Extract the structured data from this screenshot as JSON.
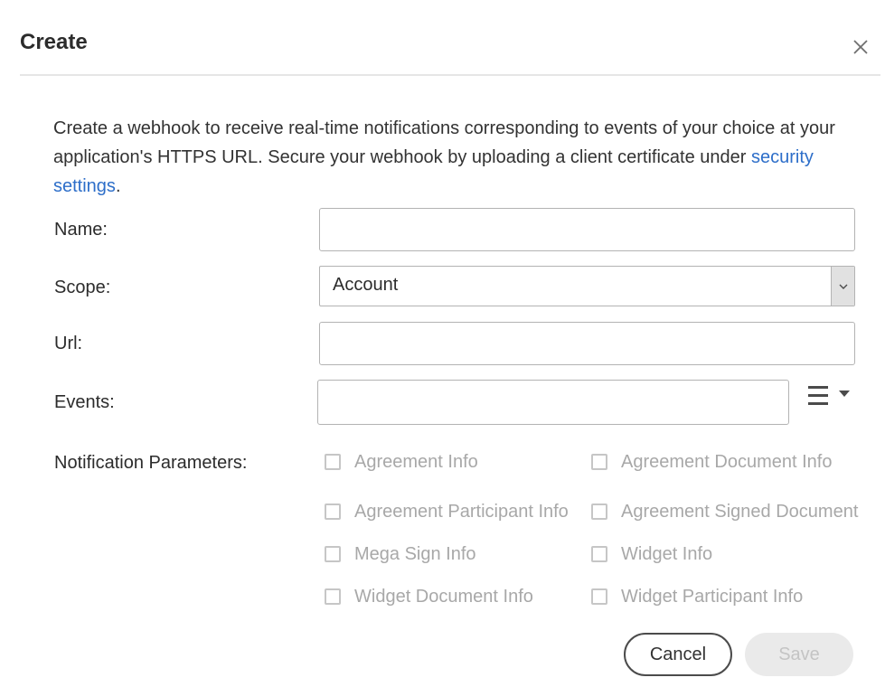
{
  "dialog": {
    "title": "Create",
    "close_icon": "close-icon"
  },
  "description": {
    "text": "Create a webhook to receive real-time notifications corresponding to events of your choice at your application's HTTPS URL. Secure your webhook by uploading a client certificate under ",
    "link_text": "security settings",
    "suffix": "."
  },
  "form": {
    "name": {
      "label": "Name:",
      "value": "",
      "placeholder": ""
    },
    "scope": {
      "label": "Scope:",
      "selected": "Account",
      "caret_icon": "chevron-down-icon"
    },
    "url": {
      "label": "Url:",
      "value": "",
      "placeholder": ""
    },
    "events": {
      "label": "Events:",
      "value": "",
      "menu_icon": "list-menu-icon"
    },
    "notification_parameters": {
      "label": "Notification Parameters:",
      "options": [
        {
          "label": "Agreement Info",
          "checked": false,
          "disabled": true
        },
        {
          "label": "Agreement Document Info",
          "checked": false,
          "disabled": true
        },
        {
          "label": "Agreement Participant Info",
          "checked": false,
          "disabled": true
        },
        {
          "label": "Agreement Signed Document",
          "checked": false,
          "disabled": true
        },
        {
          "label": "Mega Sign Info",
          "checked": false,
          "disabled": true
        },
        {
          "label": "Widget Info",
          "checked": false,
          "disabled": true
        },
        {
          "label": "Widget Document Info",
          "checked": false,
          "disabled": true
        },
        {
          "label": "Widget Participant Info",
          "checked": false,
          "disabled": true
        }
      ]
    }
  },
  "actions": {
    "cancel_label": "Cancel",
    "save_label": "Save",
    "save_disabled": true
  }
}
